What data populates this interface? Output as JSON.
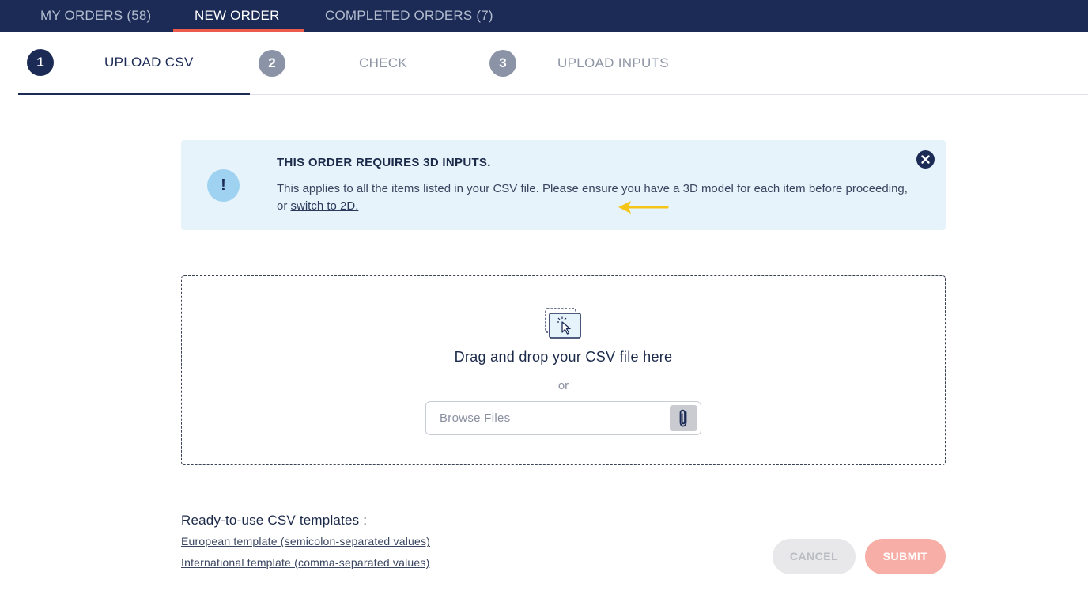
{
  "topnav": {
    "tabs": [
      {
        "label": "MY ORDERS (58)",
        "active": false
      },
      {
        "label": "NEW ORDER",
        "active": true
      },
      {
        "label": "COMPLETED ORDERS (7)",
        "active": false
      }
    ]
  },
  "stepper": {
    "steps": [
      {
        "number": "1",
        "label": "UPLOAD CSV",
        "active": true
      },
      {
        "number": "2",
        "label": "CHECK",
        "active": false
      },
      {
        "number": "3",
        "label": "UPLOAD INPUTS",
        "active": false
      }
    ]
  },
  "banner": {
    "icon": "exclamation-icon",
    "title": "THIS ORDER REQUIRES 3D INPUTS.",
    "body_text": "This applies to all the items listed in your CSV file. Please ensure you have a 3D model for each item before proceeding, or ",
    "link_text": "switch to 2D.",
    "close_icon": "close-icon"
  },
  "dropzone": {
    "icon": "drag-drop-icon",
    "text": "Drag and drop your CSV file here",
    "or_text": "or",
    "browse_placeholder": "Browse Files",
    "attach_icon": "paperclip-icon"
  },
  "templates": {
    "title": "Ready-to-use CSV templates :",
    "links": [
      "European template (semicolon-separated values)",
      "International template (comma-separated values)"
    ]
  },
  "actions": {
    "cancel_label": "CANCEL",
    "submit_label": "SUBMIT"
  },
  "colors": {
    "nav_bg": "#1c2b56",
    "accent": "#ec5b4c",
    "banner_bg": "#e6f3fb",
    "submit_disabled": "#f7aea6",
    "annotation_arrow": "#f5c518"
  }
}
